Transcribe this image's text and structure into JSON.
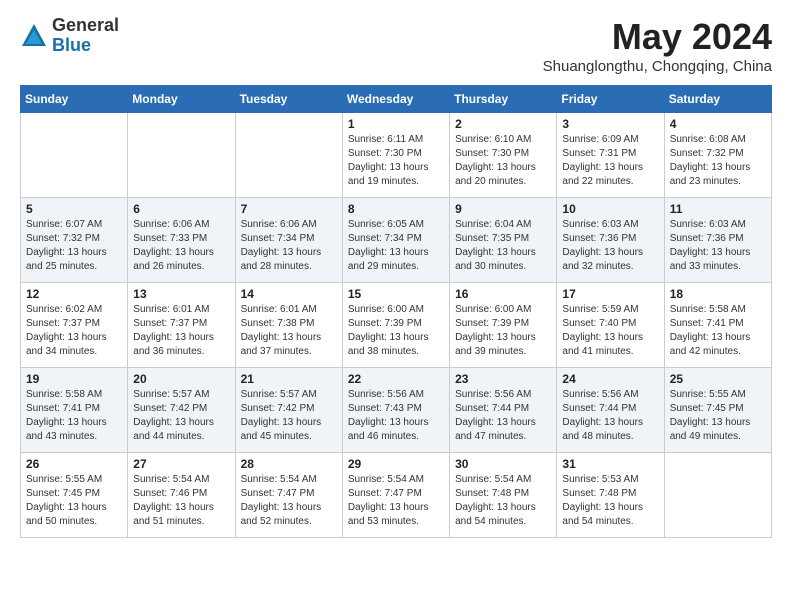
{
  "logo": {
    "general": "General",
    "blue": "Blue"
  },
  "title": {
    "month_year": "May 2024",
    "location": "Shuanglongthu, Chongqing, China"
  },
  "headers": [
    "Sunday",
    "Monday",
    "Tuesday",
    "Wednesday",
    "Thursday",
    "Friday",
    "Saturday"
  ],
  "weeks": [
    [
      {
        "day": "",
        "text": ""
      },
      {
        "day": "",
        "text": ""
      },
      {
        "day": "",
        "text": ""
      },
      {
        "day": "1",
        "text": "Sunrise: 6:11 AM\nSunset: 7:30 PM\nDaylight: 13 hours\nand 19 minutes."
      },
      {
        "day": "2",
        "text": "Sunrise: 6:10 AM\nSunset: 7:30 PM\nDaylight: 13 hours\nand 20 minutes."
      },
      {
        "day": "3",
        "text": "Sunrise: 6:09 AM\nSunset: 7:31 PM\nDaylight: 13 hours\nand 22 minutes."
      },
      {
        "day": "4",
        "text": "Sunrise: 6:08 AM\nSunset: 7:32 PM\nDaylight: 13 hours\nand 23 minutes."
      }
    ],
    [
      {
        "day": "5",
        "text": "Sunrise: 6:07 AM\nSunset: 7:32 PM\nDaylight: 13 hours\nand 25 minutes."
      },
      {
        "day": "6",
        "text": "Sunrise: 6:06 AM\nSunset: 7:33 PM\nDaylight: 13 hours\nand 26 minutes."
      },
      {
        "day": "7",
        "text": "Sunrise: 6:06 AM\nSunset: 7:34 PM\nDaylight: 13 hours\nand 28 minutes."
      },
      {
        "day": "8",
        "text": "Sunrise: 6:05 AM\nSunset: 7:34 PM\nDaylight: 13 hours\nand 29 minutes."
      },
      {
        "day": "9",
        "text": "Sunrise: 6:04 AM\nSunset: 7:35 PM\nDaylight: 13 hours\nand 30 minutes."
      },
      {
        "day": "10",
        "text": "Sunrise: 6:03 AM\nSunset: 7:36 PM\nDaylight: 13 hours\nand 32 minutes."
      },
      {
        "day": "11",
        "text": "Sunrise: 6:03 AM\nSunset: 7:36 PM\nDaylight: 13 hours\nand 33 minutes."
      }
    ],
    [
      {
        "day": "12",
        "text": "Sunrise: 6:02 AM\nSunset: 7:37 PM\nDaylight: 13 hours\nand 34 minutes."
      },
      {
        "day": "13",
        "text": "Sunrise: 6:01 AM\nSunset: 7:37 PM\nDaylight: 13 hours\nand 36 minutes."
      },
      {
        "day": "14",
        "text": "Sunrise: 6:01 AM\nSunset: 7:38 PM\nDaylight: 13 hours\nand 37 minutes."
      },
      {
        "day": "15",
        "text": "Sunrise: 6:00 AM\nSunset: 7:39 PM\nDaylight: 13 hours\nand 38 minutes."
      },
      {
        "day": "16",
        "text": "Sunrise: 6:00 AM\nSunset: 7:39 PM\nDaylight: 13 hours\nand 39 minutes."
      },
      {
        "day": "17",
        "text": "Sunrise: 5:59 AM\nSunset: 7:40 PM\nDaylight: 13 hours\nand 41 minutes."
      },
      {
        "day": "18",
        "text": "Sunrise: 5:58 AM\nSunset: 7:41 PM\nDaylight: 13 hours\nand 42 minutes."
      }
    ],
    [
      {
        "day": "19",
        "text": "Sunrise: 5:58 AM\nSunset: 7:41 PM\nDaylight: 13 hours\nand 43 minutes."
      },
      {
        "day": "20",
        "text": "Sunrise: 5:57 AM\nSunset: 7:42 PM\nDaylight: 13 hours\nand 44 minutes."
      },
      {
        "day": "21",
        "text": "Sunrise: 5:57 AM\nSunset: 7:42 PM\nDaylight: 13 hours\nand 45 minutes."
      },
      {
        "day": "22",
        "text": "Sunrise: 5:56 AM\nSunset: 7:43 PM\nDaylight: 13 hours\nand 46 minutes."
      },
      {
        "day": "23",
        "text": "Sunrise: 5:56 AM\nSunset: 7:44 PM\nDaylight: 13 hours\nand 47 minutes."
      },
      {
        "day": "24",
        "text": "Sunrise: 5:56 AM\nSunset: 7:44 PM\nDaylight: 13 hours\nand 48 minutes."
      },
      {
        "day": "25",
        "text": "Sunrise: 5:55 AM\nSunset: 7:45 PM\nDaylight: 13 hours\nand 49 minutes."
      }
    ],
    [
      {
        "day": "26",
        "text": "Sunrise: 5:55 AM\nSunset: 7:45 PM\nDaylight: 13 hours\nand 50 minutes."
      },
      {
        "day": "27",
        "text": "Sunrise: 5:54 AM\nSunset: 7:46 PM\nDaylight: 13 hours\nand 51 minutes."
      },
      {
        "day": "28",
        "text": "Sunrise: 5:54 AM\nSunset: 7:47 PM\nDaylight: 13 hours\nand 52 minutes."
      },
      {
        "day": "29",
        "text": "Sunrise: 5:54 AM\nSunset: 7:47 PM\nDaylight: 13 hours\nand 53 minutes."
      },
      {
        "day": "30",
        "text": "Sunrise: 5:54 AM\nSunset: 7:48 PM\nDaylight: 13 hours\nand 54 minutes."
      },
      {
        "day": "31",
        "text": "Sunrise: 5:53 AM\nSunset: 7:48 PM\nDaylight: 13 hours\nand 54 minutes."
      },
      {
        "day": "",
        "text": ""
      }
    ]
  ]
}
